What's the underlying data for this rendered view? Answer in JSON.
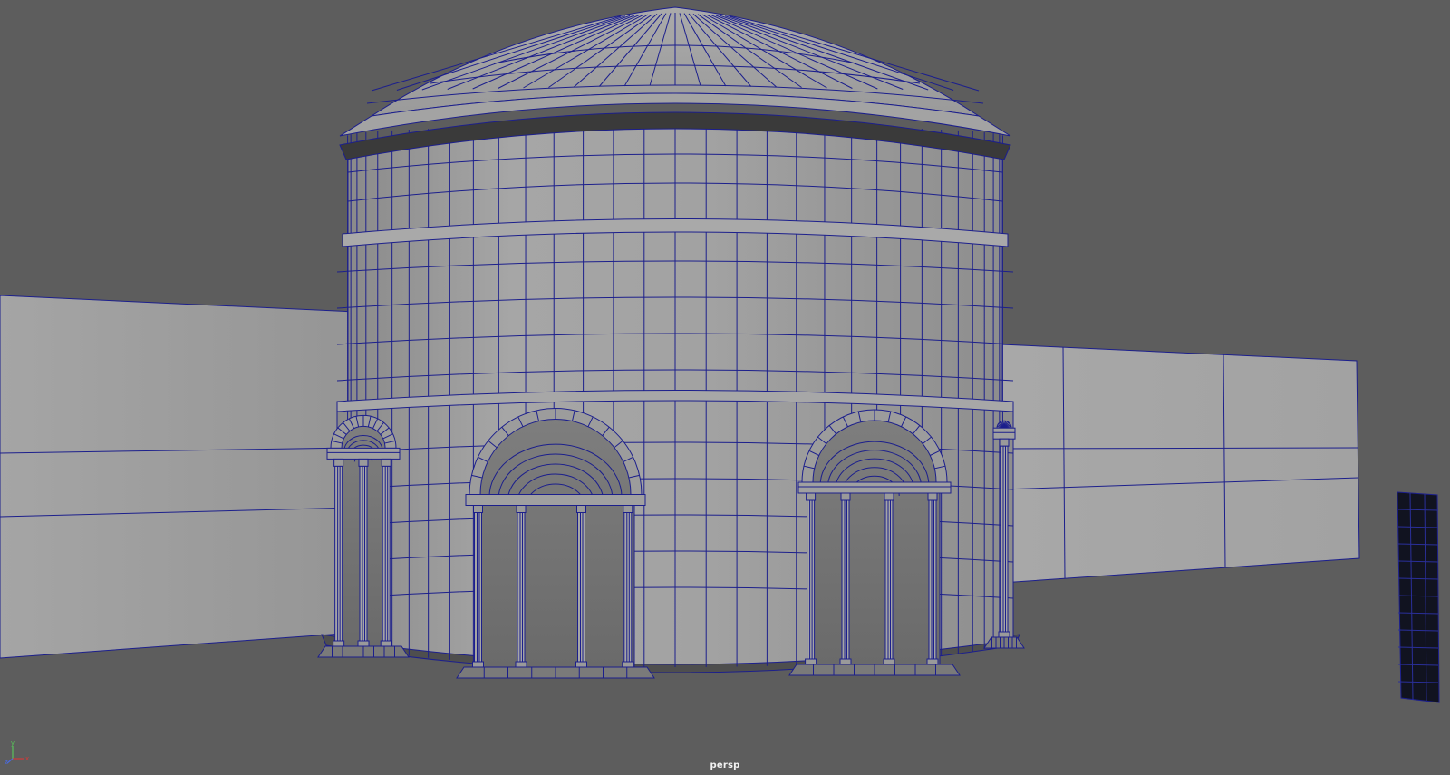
{
  "viewport": {
    "camera_name": "persp",
    "shading_mode": "wireframe-on-shaded",
    "wire_color": "#1c1f8c",
    "background_color": "#5d5d5d",
    "surface_color": "#9d9d9d"
  },
  "axis_gizmo": {
    "x_label": "x",
    "y_label": "y",
    "z_label": "z",
    "x_color": "#d23a3a",
    "y_color": "#58c45a",
    "z_color": "#4a6ae0"
  },
  "icons": {
    "axis": "axis-gizmo-icon"
  }
}
